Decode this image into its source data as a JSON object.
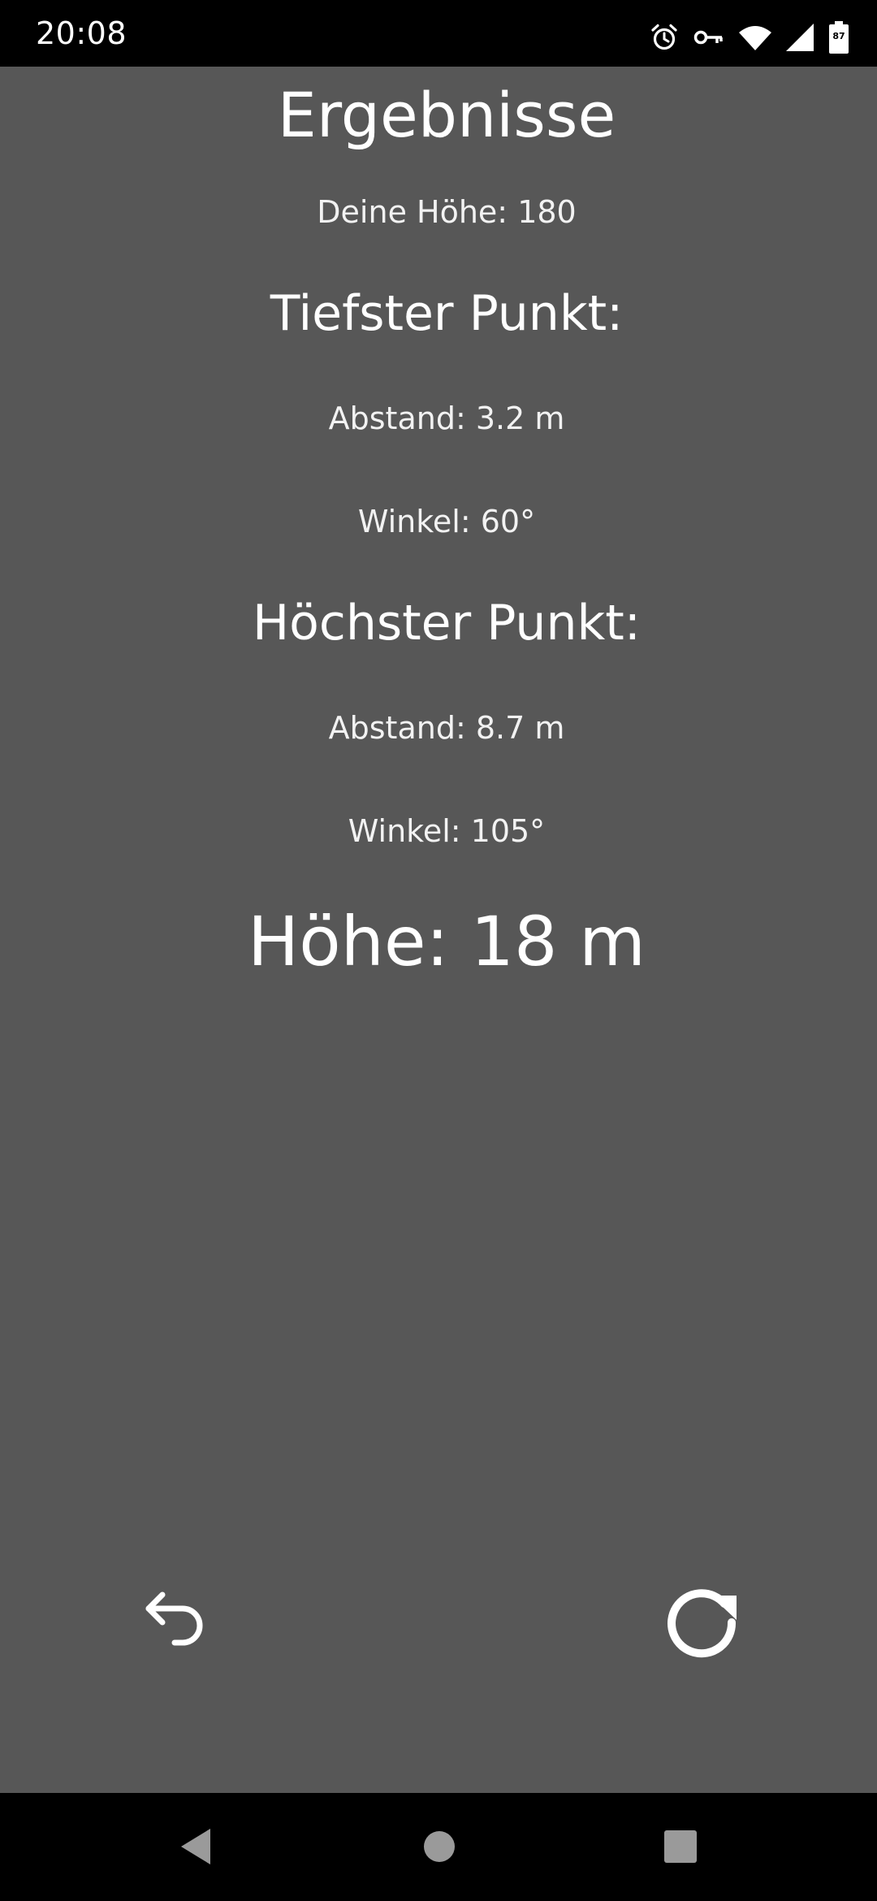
{
  "status_bar": {
    "time": "20:08",
    "battery_level": "87",
    "icons": [
      "alarm-icon",
      "vpn-key-icon",
      "wifi-icon",
      "cellular-signal-icon",
      "battery-icon"
    ]
  },
  "results": {
    "title": "Ergebnisse",
    "user_height": "Deine Höhe: 180",
    "lowest_point": {
      "heading": "Tiefster Punkt:",
      "distance": "Abstand: 3.2 m",
      "angle": "Winkel: 60°"
    },
    "highest_point": {
      "heading": "Höchster Punkt:",
      "distance": "Abstand: 8.7 m",
      "angle": "Winkel: 105°"
    },
    "height_result": "Höhe: 18 m"
  },
  "actions": {
    "back_icon": "undo-arrow-icon",
    "reload_icon": "reload-icon"
  },
  "navigation_bar": {
    "icons": [
      "nav-back-icon",
      "nav-home-icon",
      "nav-recents-icon"
    ]
  },
  "colors": {
    "background": "#575757",
    "text": "#ffffff",
    "system_bars": "#000000"
  }
}
